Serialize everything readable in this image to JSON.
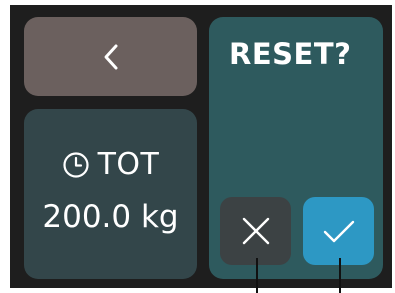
{
  "back_button": {
    "icon": "chevron-left-icon"
  },
  "total": {
    "icon": "clock-icon",
    "label": "TOT",
    "value": "200.0 kg"
  },
  "reset_dialog": {
    "title": "RESET?",
    "cancel_icon": "close-icon",
    "confirm_icon": "check-icon"
  },
  "colors": {
    "display_background": "#1e1e1e",
    "back_button": "#6b605e",
    "total_panel": "#33464a",
    "reset_panel": "#2e5a5e",
    "cancel_button": "#3c4244",
    "confirm_button": "#2d98c4",
    "text": "#ffffff"
  }
}
